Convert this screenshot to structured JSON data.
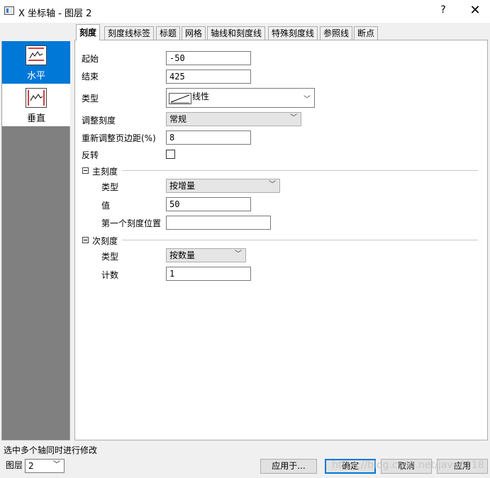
{
  "window": {
    "title": "X 坐标轴 - 图层 2",
    "help": "?",
    "close": "✕"
  },
  "axes": [
    {
      "label": "水平",
      "selected": true
    },
    {
      "label": "垂直",
      "selected": false
    }
  ],
  "tabs": [
    "刻度",
    "刻度线标签",
    "标题",
    "网格",
    "轴线和刻度线",
    "特殊刻度线",
    "参照线",
    "断点"
  ],
  "active_tab": "刻度",
  "form": {
    "start": {
      "label": "起始",
      "value": "-50"
    },
    "end": {
      "label": "结束",
      "value": "425"
    },
    "type": {
      "label": "类型",
      "value": "线性"
    },
    "rescale": {
      "label": "调整刻度",
      "value": "常规"
    },
    "rescale_margin": {
      "label": "重新调整页边距(%)",
      "value": "8"
    },
    "reverse": {
      "label": "反转",
      "checked": false
    },
    "major": {
      "header": "主刻度",
      "type_label": "类型",
      "type_value": "按增量",
      "value_label": "值",
      "value": "50",
      "first_label": "第一个刻度位置",
      "first_value": ""
    },
    "minor": {
      "header": "次刻度",
      "type_label": "类型",
      "type_value": "按数量",
      "count_label": "计数",
      "count": "1"
    }
  },
  "status": "选中多个轴同时进行修改",
  "layer": {
    "label": "图层",
    "value": "2"
  },
  "buttons": {
    "apply_to": "应用于...",
    "ok": "确定",
    "cancel": "取消",
    "apply": "应用"
  },
  "watermark": "https://blog.csdn.net/java6118"
}
